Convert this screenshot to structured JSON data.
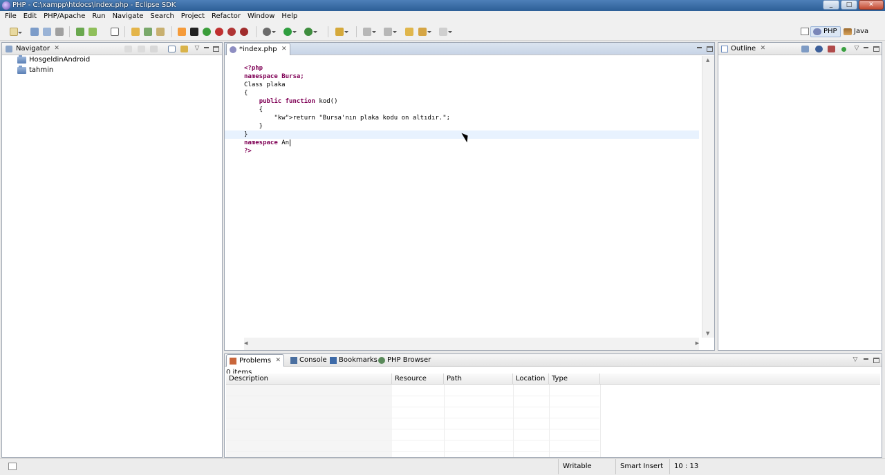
{
  "window": {
    "title": "PHP - C:\\xampp\\htdocs\\index.php - Eclipse SDK"
  },
  "menu": [
    "File",
    "Edit",
    "PHP/Apache",
    "Run",
    "Navigate",
    "Search",
    "Project",
    "Refactor",
    "Window",
    "Help"
  ],
  "perspectives": {
    "php": "PHP",
    "java": "Java"
  },
  "navigator": {
    "tab": "Navigator",
    "items": [
      "HosgeldinAndroid",
      "tahmin"
    ]
  },
  "editor": {
    "tab": "*index.php",
    "lines": [
      "<?php",
      "namespace Bursa;",
      "Class plaka",
      "{",
      "    public function kod()",
      "    {",
      "        return \"Bursa'nın plaka kodu on altıdır.\";",
      "    }",
      "}",
      "namespace An",
      "?>"
    ]
  },
  "outline": {
    "tab": "Outline"
  },
  "bottom": {
    "tabs": [
      "Problems",
      "Console",
      "Bookmarks",
      "PHP Browser"
    ],
    "summary": "0 items",
    "columns": [
      "Description",
      "Resource",
      "Path",
      "Location",
      "Type"
    ]
  },
  "status": {
    "writable": "Writable",
    "insert_mode": "Smart Insert",
    "position": "10 : 13"
  },
  "colors": {
    "keyword": "#7f0055",
    "string": "#2a00ff",
    "titlebar": "#3a6ba6"
  }
}
